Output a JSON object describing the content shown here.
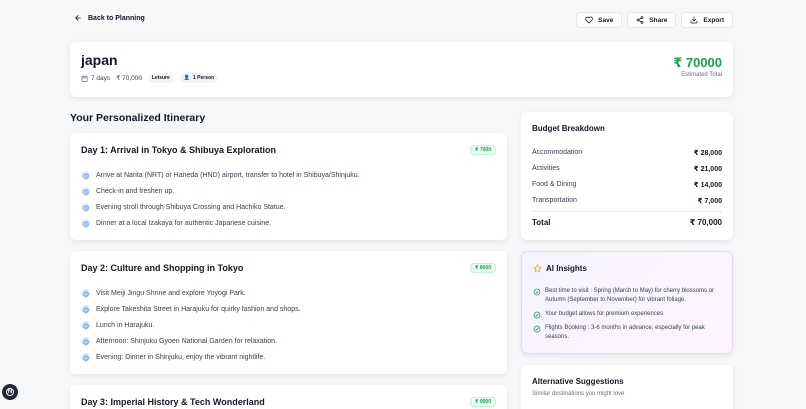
{
  "nav": {
    "back_label": "Back to Planning",
    "save_label": "Save",
    "share_label": "Share",
    "export_label": "Export"
  },
  "trip": {
    "title": "japan",
    "duration": "7 days",
    "budget": "₹ 70,000",
    "style_tag": "Leisure",
    "travelers": "1 Person",
    "total_amount": "₹ 70000",
    "total_label": "Estimated Total"
  },
  "itinerary": {
    "heading": "Your Personalized Itinerary",
    "days": [
      {
        "title": "Day 1: Arrival in Tokyo & Shibuya Exploration",
        "cost": "₹ 7000",
        "activities": [
          "Arrive at Narita (NRT) or Haneda (HND) airport, transfer to hotel in Shibuya/Shinjuku.",
          "Check-in and freshen up.",
          "Evening stroll through Shibuya Crossing and Hachiko Statue.",
          "Dinner at a local Izakaya for authentic Japanese cuisine."
        ]
      },
      {
        "title": "Day 2: Culture and Shopping in Tokyo",
        "cost": "₹ 8000",
        "activities": [
          "Visit Meiji Jingu Shrine and explore Yoyogi Park.",
          "Explore Takeshita Street in Harajuku for quirky fashion and shops.",
          "Lunch in Harajuku.",
          "Afternoon: Shinjuku Gyoen National Garden for relaxation.",
          "Evening: Dinner in Shinjuku, enjoy the vibrant nightlife."
        ]
      },
      {
        "title": "Day 3: Imperial History & Tech Wonderland",
        "cost": "₹ 9000",
        "activities": []
      }
    ]
  },
  "budget": {
    "title": "Budget Breakdown",
    "rows": [
      {
        "label": "Accommodation",
        "value": "₹ 28,000"
      },
      {
        "label": "Activities",
        "value": "₹ 21,000"
      },
      {
        "label": "Food & Dining",
        "value": "₹ 14,000"
      },
      {
        "label": "Transportation",
        "value": "₹ 7,000"
      }
    ],
    "total_label": "Total",
    "total_value": "₹ 70,000"
  },
  "ai_insights": {
    "title": "AI Insights",
    "items": [
      "Best time to visit : Spring (March to May) for cherry blossoms or Autumn (September to November) for vibrant foliage.",
      "Your budget allows for premium experiences",
      "Flights Booking : 3-6 months in advance, especially for peak seasons."
    ]
  },
  "alternatives": {
    "title": "Alternative Suggestions",
    "subtitle": "Similar destinations you might love"
  },
  "fab": {
    "label": "N"
  },
  "colors": {
    "accent_green": "#16a34a",
    "activity_blue": "#3b82f6",
    "star_yellow": "#eab308"
  }
}
